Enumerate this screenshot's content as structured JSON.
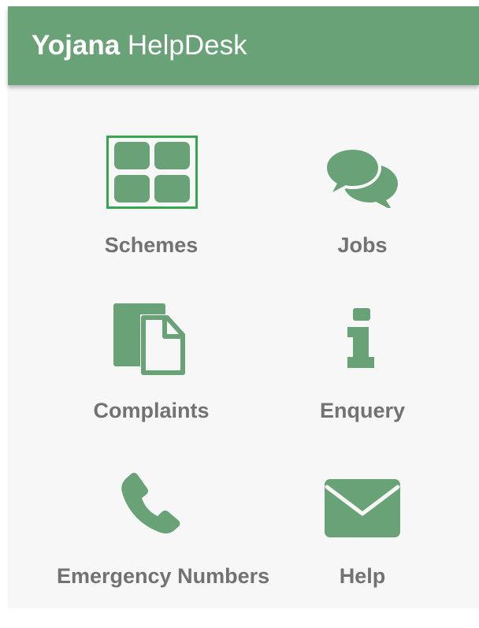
{
  "app_bar": {
    "title_bold": "Yojana",
    "title_rest": "HelpDesk"
  },
  "colors": {
    "app_bar": "#6aa278",
    "icon": "#6aa278",
    "label": "#727272",
    "selected_border": "#36a64f",
    "background": "#f7f7f7"
  },
  "menu": [
    {
      "id": "schemes",
      "label": "Schemes",
      "icon": "grid-icon",
      "selected": true
    },
    {
      "id": "jobs",
      "label": "Jobs",
      "icon": "chat-bubbles-icon",
      "selected": false
    },
    {
      "id": "complaints",
      "label": "Complaints",
      "icon": "documents-icon",
      "selected": false
    },
    {
      "id": "enquery",
      "label": "Enquery",
      "icon": "info-icon",
      "selected": false
    },
    {
      "id": "emergency",
      "label": "Emergency Numbers",
      "icon": "phone-icon",
      "selected": false
    },
    {
      "id": "help",
      "label": "Help",
      "icon": "envelope-icon",
      "selected": false
    }
  ]
}
